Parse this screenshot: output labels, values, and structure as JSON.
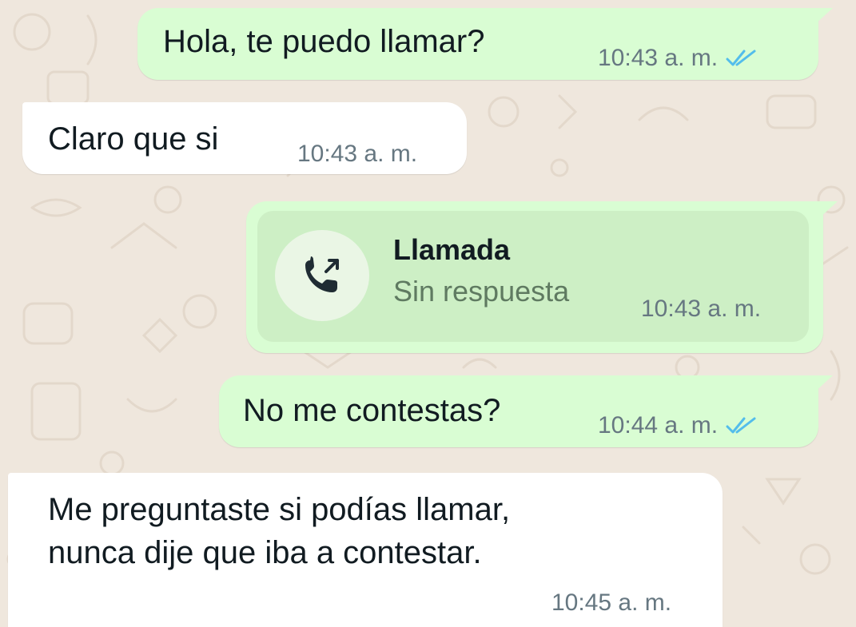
{
  "messages": [
    {
      "direction": "outgoing",
      "text": "Hola, te puedo llamar?",
      "time": "10:43 a. m.",
      "status_icon": "double-check-read-icon"
    },
    {
      "direction": "incoming",
      "text": "Claro que si",
      "time": "10:43 a. m."
    },
    {
      "direction": "outgoing",
      "type": "call",
      "call_title": "Llamada",
      "call_status": "Sin respuesta",
      "time": "10:43 a. m.",
      "icon": "outgoing-call-phone-icon"
    },
    {
      "direction": "outgoing",
      "text": "No me contestas?",
      "time": "10:44 a. m.",
      "status_icon": "double-check-read-icon"
    },
    {
      "direction": "incoming",
      "lines": [
        "Me preguntaste si podías llamar,",
        "nunca dije que iba a contestar."
      ],
      "time": "10:45 a. m."
    }
  ],
  "colors": {
    "background": "#efe7dd",
    "outgoing_bubble": "#d9fdd3",
    "incoming_bubble": "#ffffff",
    "call_card": "#cdefc5",
    "read_ticks": "#53bdeb",
    "meta_text": "#667781"
  }
}
